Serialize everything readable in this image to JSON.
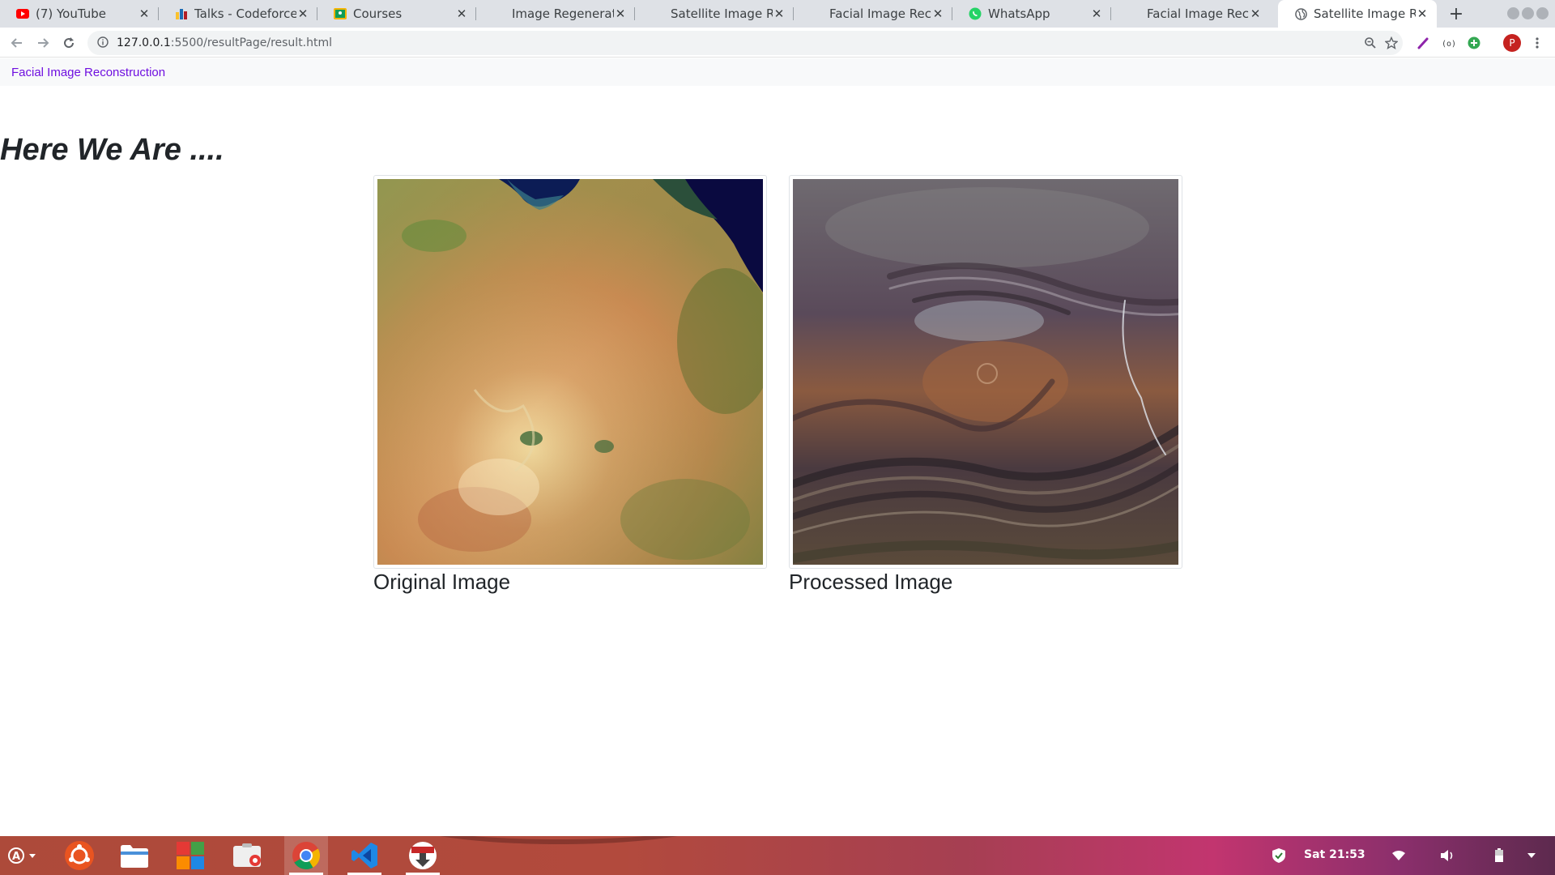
{
  "browser": {
    "tabs": [
      {
        "title": "(7) YouTube",
        "favicon": "youtube-icon",
        "active": false
      },
      {
        "title": "Talks - Codeforces",
        "favicon": "codeforces-icon",
        "active": false
      },
      {
        "title": "Courses",
        "favicon": "classroom-icon",
        "active": false
      },
      {
        "title": "Image Regeneration",
        "favicon": "",
        "active": false
      },
      {
        "title": "Satellite Image Reg",
        "favicon": "",
        "active": false
      },
      {
        "title": "Facial Image Recons",
        "favicon": "",
        "active": false
      },
      {
        "title": "WhatsApp",
        "favicon": "whatsapp-icon",
        "active": false
      },
      {
        "title": "Facial Image Recons",
        "favicon": "",
        "active": false
      },
      {
        "title": "Satellite Image Reg",
        "favicon": "globe-icon",
        "active": true
      }
    ],
    "url_host": "127.0.0.1",
    "url_path": ":5500/resultPage/result.html"
  },
  "page": {
    "brand": "Facial Image Reconstruction",
    "heading": "Here We Are ....",
    "images": [
      {
        "caption": "Original Image",
        "alt": "Original satellite image"
      },
      {
        "caption": "Processed Image",
        "alt": "Processed satellite image"
      }
    ]
  },
  "taskbar": {
    "items": [
      {
        "name": "ubuntu-software-icon"
      },
      {
        "name": "files-icon"
      },
      {
        "name": "app-grid-icon"
      },
      {
        "name": "screenshot-icon"
      },
      {
        "name": "chrome-icon"
      },
      {
        "name": "vscode-icon"
      },
      {
        "name": "installer-icon"
      }
    ],
    "clock": "Sat 21:53"
  },
  "colors": {
    "brand_link": "#6f0fe0",
    "tab_strip": "#dee1e6",
    "taskbar_start": "#ad4a3a",
    "taskbar_end": "#5d2a4e"
  }
}
